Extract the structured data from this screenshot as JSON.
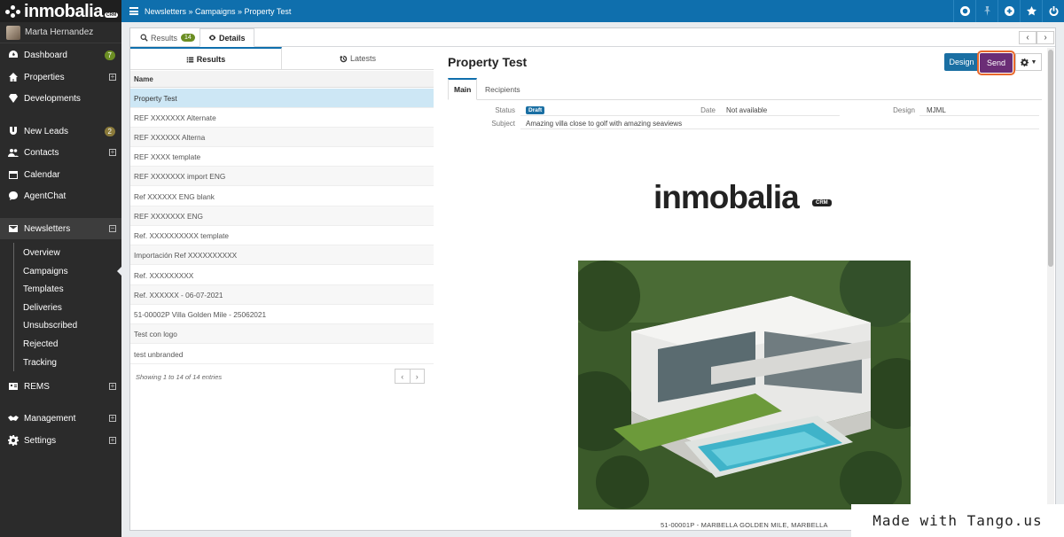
{
  "brand": {
    "name": "inmobalia",
    "badge": "CRM"
  },
  "user": {
    "name": "Marta Hernandez"
  },
  "sidebar": {
    "items": [
      {
        "label": "Dashboard",
        "badge": "7"
      },
      {
        "label": "Properties"
      },
      {
        "label": "Developments"
      },
      {
        "label": "New Leads",
        "badge": "2"
      },
      {
        "label": "Contacts"
      },
      {
        "label": "Calendar"
      },
      {
        "label": "AgentChat"
      },
      {
        "label": "Newsletters"
      },
      {
        "label": "REMS"
      },
      {
        "label": "Management"
      },
      {
        "label": "Settings"
      }
    ],
    "submenu": [
      "Overview",
      "Campaigns",
      "Templates",
      "Deliveries",
      "Unsubscribed",
      "Rejected",
      "Tracking"
    ]
  },
  "topbar": {
    "breadcrumb": "Newsletters » Campaigns » Property Test"
  },
  "tabs": {
    "results_label": "Results",
    "results_count": "14",
    "details_label": "Details"
  },
  "list": {
    "subtab_results": "Results",
    "subtab_latests": "Latests",
    "column_name": "Name",
    "rows": [
      "Property Test",
      "REF XXXXXXX Alternate",
      "REF XXXXXX Alterna",
      "REF XXXX template",
      "REF XXXXXXX import ENG",
      "Ref XXXXXX ENG blank",
      "REF XXXXXXX ENG",
      "Ref. XXXXXXXXXX template",
      "Importación Ref XXXXXXXXXX",
      "Ref. XXXXXXXXX",
      "Ref. XXXXXX - 06-07-2021",
      "51-00002P Villa Golden Mile - 25062021",
      "Test con logo",
      "test unbranded"
    ],
    "footer": "Showing 1 to 14 of 14 entries"
  },
  "detail": {
    "title": "Property Test",
    "design_button": "Design",
    "send_button": "Send",
    "tab_main": "Main",
    "tab_recipients": "Recipients",
    "status_label": "Status",
    "status_value": "Draft",
    "date_label": "Date",
    "date_value": "Not available",
    "design_label": "Design",
    "design_value": "MJML",
    "subject_label": "Subject",
    "subject_value": "Amazing villa close to golf with amazing seaviews",
    "preview_logo": "inmobalia",
    "preview_crm": "CRM",
    "caption": "51-00001P  -  MARBELLA GOLDEN MILE, MARBELLA"
  },
  "watermark": "Made with Tango.us"
}
